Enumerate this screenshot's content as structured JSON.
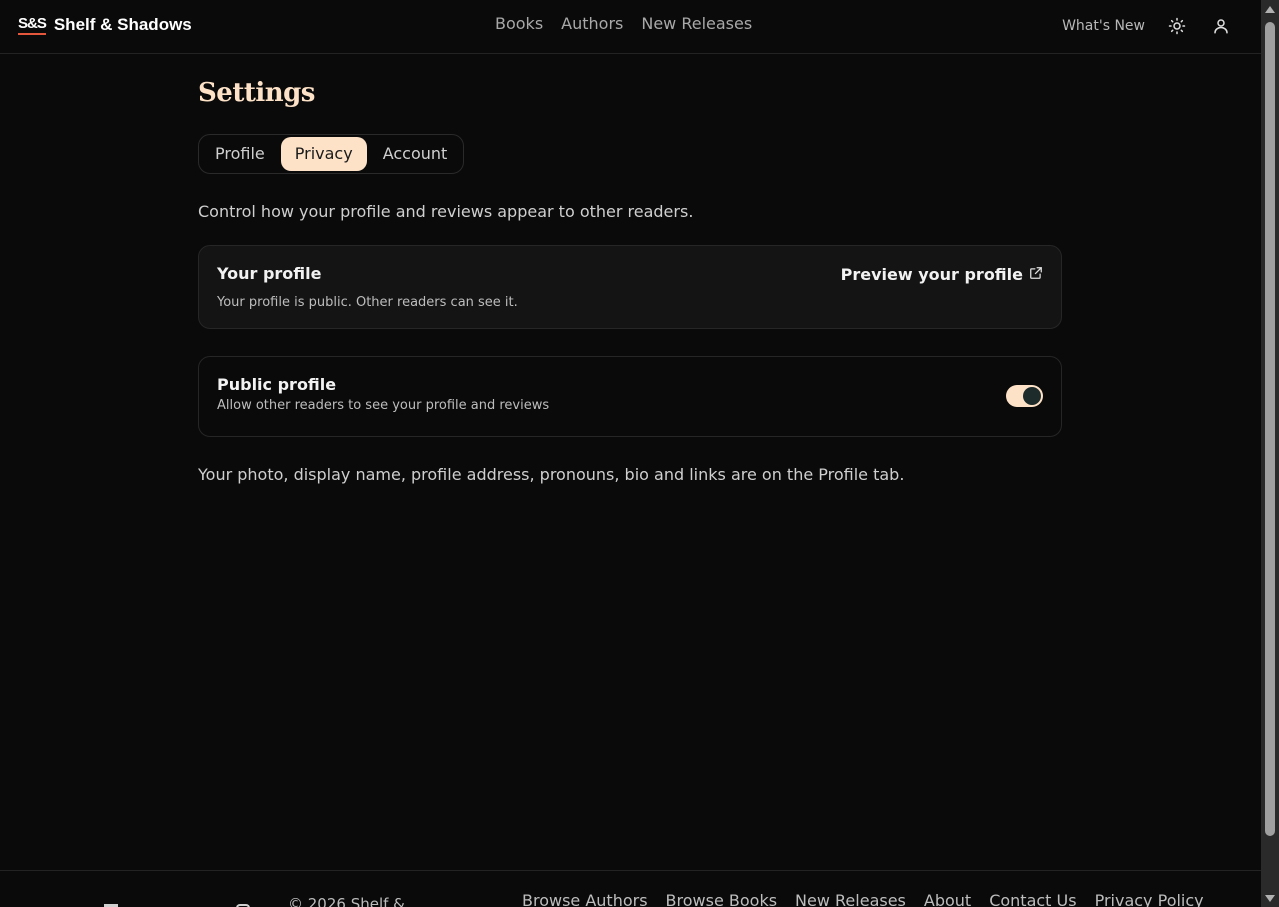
{
  "header": {
    "brand_mark": "S&S",
    "brand_name": "Shelf & Shadows",
    "nav": [
      "Books",
      "Authors",
      "New Releases"
    ],
    "whats_new": "What's New",
    "theme_icon": "sun-icon",
    "user_icon": "user-icon"
  },
  "settings": {
    "title": "Settings",
    "tabs": [
      "Profile",
      "Privacy",
      "Account"
    ],
    "active_tab": "Privacy",
    "intro": "Control how your profile and reviews appear to other readers.",
    "profile_card": {
      "title": "Your profile",
      "status": "Your profile is public. Other readers can see it.",
      "preview_link": "Preview your profile",
      "preview_icon": "external-link-icon"
    },
    "public_profile": {
      "title": "Public profile",
      "description": "Allow other readers to see your profile and reviews",
      "enabled": true
    },
    "footnote": "Your photo, display name, profile address, pronouns, bio and links are on the Profile tab."
  },
  "footer": {
    "copyright": "© 2026 Shelf &",
    "links": [
      "Browse Authors",
      "Browse Books",
      "New Releases",
      "About",
      "Contact Us",
      "Privacy Policy"
    ]
  },
  "colors": {
    "background": "#0a0a0a",
    "accent": "#fde2c8",
    "brand_underline": "#e4573d",
    "toggle_knob": "#1d2b2a"
  }
}
